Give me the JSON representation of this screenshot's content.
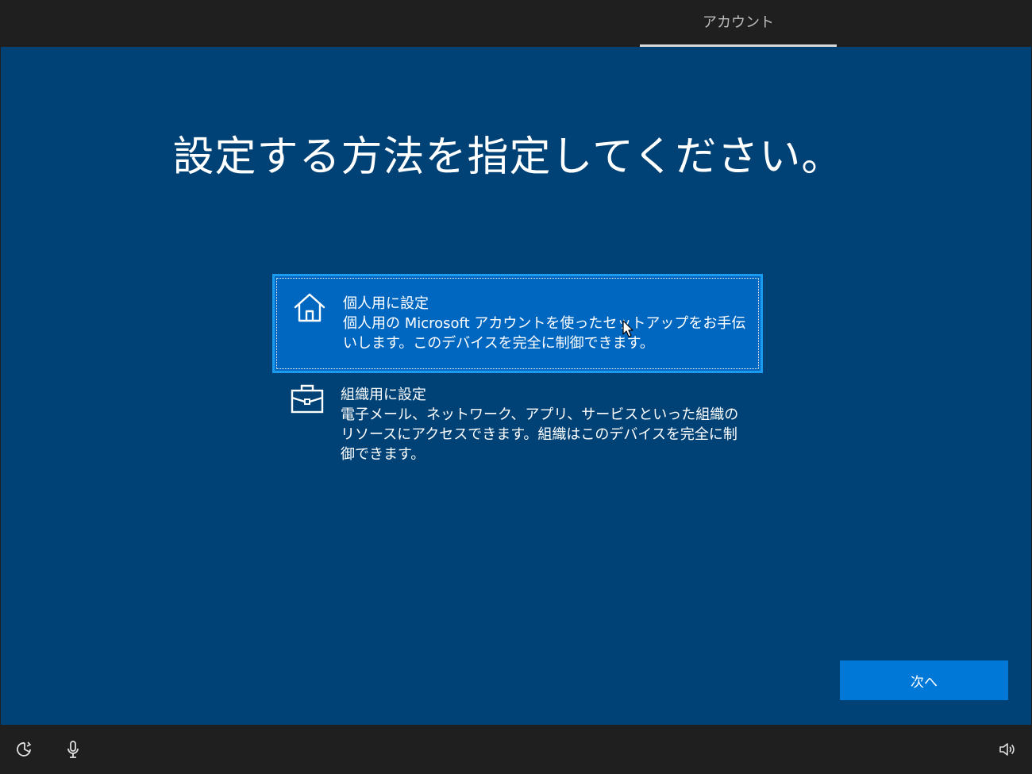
{
  "header": {
    "tab_label": "アカウント"
  },
  "main": {
    "title": "設定する方法を指定してください。",
    "options": [
      {
        "title": "個人用に設定",
        "description": "個人用の Microsoft アカウントを使ったセットアップをお手伝いします。このデバイスを完全に制御できます。",
        "icon": "home-icon",
        "selected": true
      },
      {
        "title": "組織用に設定",
        "description": "電子メール、ネットワーク、アプリ、サービスといった組織のリソースにアクセスできます。組織はこのデバイスを完全に制御できます。",
        "icon": "briefcase-icon",
        "selected": false
      }
    ],
    "next_label": "次へ"
  },
  "footer": {
    "icons": [
      "ease-of-access-icon",
      "microphone-icon",
      "volume-icon"
    ]
  },
  "colors": {
    "background": "#004275",
    "selected_option": "#0067c0",
    "selected_border": "#1a9bf0",
    "button": "#0078d7",
    "bars": "#1f1f1f"
  }
}
